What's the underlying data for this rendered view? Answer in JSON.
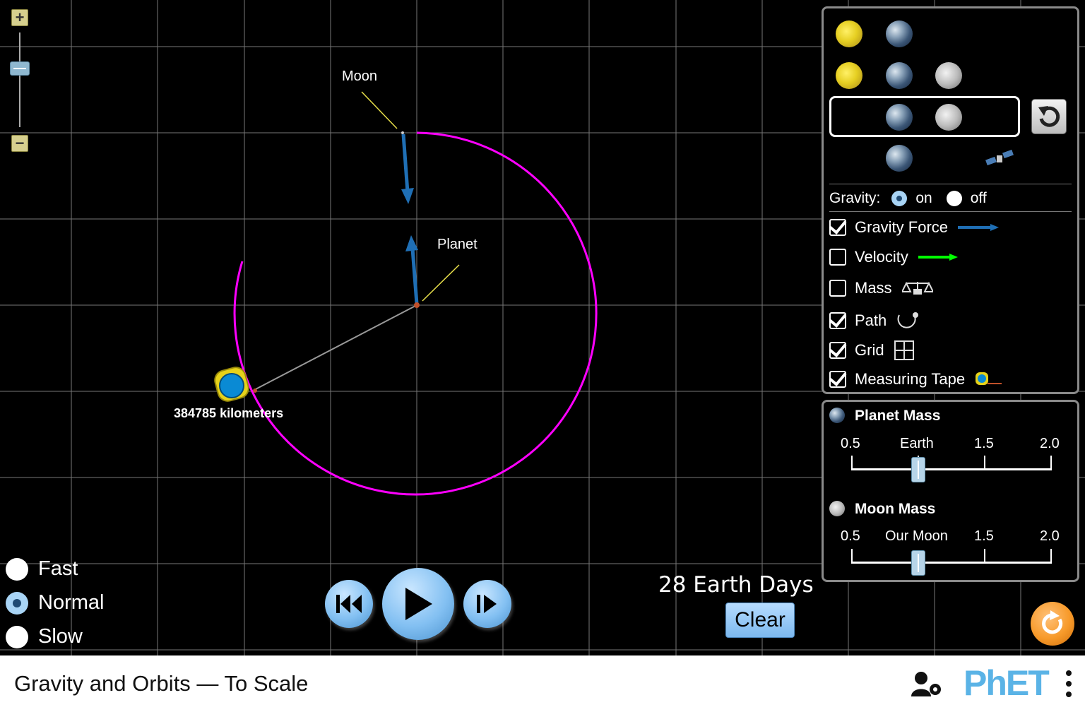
{
  "window_title": "Gravity and Orbits — To Scale",
  "scene": {
    "moon_label": "Moon",
    "planet_label": "Planet",
    "measuring_tape_readout": "384785 kilometers"
  },
  "zoom": {
    "in_label": "+",
    "out_label": "−"
  },
  "controls": {
    "gravity_label": "Gravity:",
    "gravity_on": "on",
    "gravity_off": "off",
    "gravity_selected": "on",
    "options": [
      {
        "label": "Gravity Force",
        "checked": true
      },
      {
        "label": "Velocity",
        "checked": false
      },
      {
        "label": "Mass",
        "checked": false
      },
      {
        "label": "Path",
        "checked": true
      },
      {
        "label": "Grid",
        "checked": true
      },
      {
        "label": "Measuring Tape",
        "checked": true
      }
    ]
  },
  "mass_sliders": {
    "planet": {
      "title": "Planet Mass",
      "ticks": [
        "0.5",
        "Earth",
        "1.5",
        "2.0"
      ],
      "value": 1.0
    },
    "moon": {
      "title": "Moon Mass",
      "ticks": [
        "0.5",
        "Our Moon",
        "1.5",
        "2.0"
      ],
      "value": 1.0
    }
  },
  "speed": {
    "options": [
      "Fast",
      "Normal",
      "Slow"
    ],
    "selected": "Normal"
  },
  "time": {
    "elapsed": "28 Earth Days",
    "clear_label": "Clear"
  },
  "branding": {
    "logo_text": "PhET"
  },
  "colors": {
    "orbit_path": "#ff00ff",
    "gravity_force": "#1f6fb5",
    "velocity": "#00ff00",
    "grid": "#777777",
    "reset": "#f79a2a"
  }
}
